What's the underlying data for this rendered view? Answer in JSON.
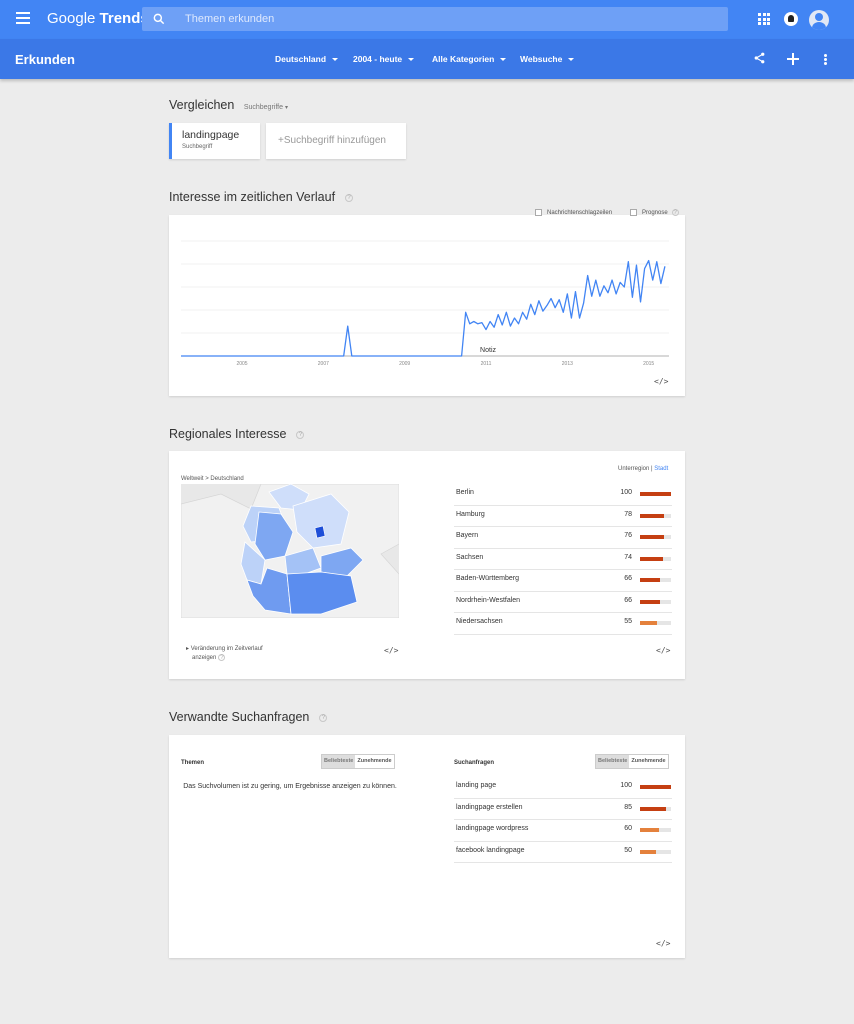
{
  "header": {
    "logo_light": "Google",
    "logo_bold": "Trends",
    "search_placeholder": "Themen erkunden"
  },
  "subheader": {
    "title": "Erkunden",
    "filters": [
      "Deutschland",
      "2004 - heute",
      "Alle Kategorien",
      "Websuche"
    ]
  },
  "compare": {
    "title": "Vergleichen",
    "mode": "Suchbegriffe",
    "term": "landingpage",
    "term_type": "Suchbegriff",
    "add_label": "+Suchbegriff hinzufügen"
  },
  "interest_over_time": {
    "title": "Interesse im zeitlichen Verlauf",
    "checkbox_news": "Nachrichtenschlagzeilen",
    "checkbox_forecast": "Prognose",
    "note_label": "Notiz",
    "embed": "</>"
  },
  "chart_data": {
    "type": "line",
    "title": "",
    "xlabel": "",
    "ylabel": "",
    "x_ticks": [
      "2005",
      "2007",
      "2009",
      "2011",
      "2013",
      "2015"
    ],
    "ylim": [
      0,
      100
    ],
    "grid": true,
    "series": [
      {
        "color": "#4285f4",
        "x": [
          2004.0,
          2004.5,
          2005.0,
          2005.5,
          2006.0,
          2006.5,
          2007.0,
          2007.5,
          2007.75,
          2007.9,
          2008.0,
          2008.1,
          2008.2,
          2008.5,
          2008.75,
          2009.0,
          2009.1,
          2009.2,
          2009.3,
          2009.4,
          2009.5,
          2009.6,
          2009.7,
          2009.8,
          2009.9,
          2010.0,
          2010.1,
          2010.2,
          2010.3,
          2010.4,
          2010.5,
          2010.6,
          2010.7,
          2010.8,
          2010.9,
          2011.0,
          2011.1,
          2011.2,
          2011.3,
          2011.4,
          2011.5,
          2011.6,
          2011.7,
          2011.8,
          2011.9,
          2012.0,
          2012.1,
          2012.2,
          2012.3,
          2012.4,
          2012.5,
          2012.6,
          2012.7,
          2012.8,
          2012.9,
          2013.0,
          2013.1,
          2013.2,
          2013.3,
          2013.4,
          2013.5,
          2013.6,
          2013.7,
          2013.8,
          2013.9,
          2014.0,
          2014.1,
          2014.2,
          2014.3,
          2014.4,
          2014.5,
          2014.6,
          2014.7,
          2014.8,
          2014.9,
          2015.0,
          2015.1,
          2015.2,
          2015.3,
          2015.4,
          2015.5,
          2015.6,
          2015.7,
          2015.8,
          2015.9
        ],
        "values": [
          0,
          0,
          0,
          0,
          0,
          0,
          0,
          0,
          0,
          0,
          0,
          26,
          0,
          0,
          0,
          0,
          0,
          0,
          0,
          0,
          0,
          0,
          0,
          0,
          0,
          0,
          0,
          0,
          0,
          0,
          0,
          0,
          0,
          0,
          0,
          38,
          28,
          30,
          28,
          29,
          23,
          30,
          25,
          36,
          27,
          38,
          26,
          33,
          28,
          38,
          32,
          45,
          36,
          48,
          39,
          44,
          50,
          42,
          49,
          38,
          54,
          33,
          56,
          33,
          46,
          70,
          52,
          66,
          52,
          61,
          55,
          66,
          54,
          64,
          60,
          82,
          51,
          79,
          47,
          76,
          83,
          66,
          82,
          63,
          78
        ]
      }
    ]
  },
  "regional": {
    "title": "Regionales Interesse",
    "toggle_sub": "Unterregion",
    "toggle_sep": "|",
    "toggle_city": "Stadt",
    "breadcrumb": "Weltweit > Deutschland",
    "change_label_1": "Veränderung im Zeitverlauf",
    "change_label_2": "anzeigen",
    "embed_left": "</>",
    "embed_right": "</>",
    "rows": [
      {
        "name": "Berlin",
        "value": 100
      },
      {
        "name": "Hamburg",
        "value": 78
      },
      {
        "name": "Bayern",
        "value": 76
      },
      {
        "name": "Sachsen",
        "value": 74
      },
      {
        "name": "Baden-Württemberg",
        "value": 66
      },
      {
        "name": "Nordrhein-Westfalen",
        "value": 66
      },
      {
        "name": "Niedersachsen",
        "value": 55
      }
    ]
  },
  "related": {
    "title": "Verwandte Suchanfragen",
    "topics_title": "Themen",
    "queries_title": "Suchanfragen",
    "toggle_top": "Beliebteste",
    "toggle_rising": "Zunehmende",
    "topics_empty": "Das Suchvolumen ist zu gering, um Ergebnisse anzeigen zu können.",
    "embed": "</>",
    "queries": [
      {
        "name": "landing page",
        "value": 100
      },
      {
        "name": "landingpage erstellen",
        "value": 85
      },
      {
        "name": "landingpage wordpress",
        "value": 60
      },
      {
        "name": "facebook landingpage",
        "value": 50
      }
    ]
  },
  "colors": {
    "primary": "#4285f4",
    "subbar": "#3b78e7",
    "bar_strong": "#c53f12",
    "bar_light": "#e4813c"
  }
}
